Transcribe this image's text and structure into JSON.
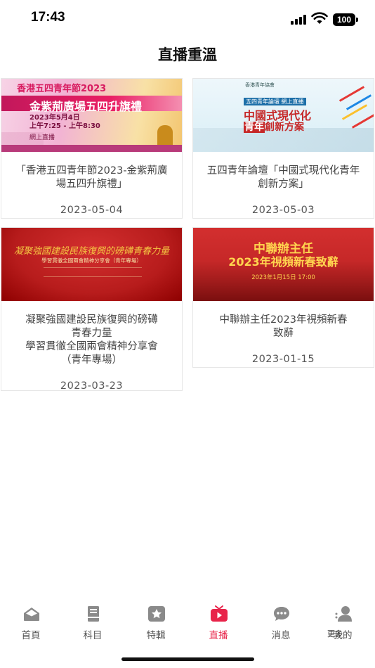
{
  "status_bar": {
    "time": "17:43",
    "battery": "100"
  },
  "page_title": "直播重溫",
  "cards": [
    {
      "title": "「香港五四青年節2023-金紫荊廣場五四升旗禮」",
      "date": "2023-05-04",
      "thumb": {
        "line1": "香港五四青年節2023",
        "line2": "金紫荊廣場五四升旗禮",
        "line3": "2023年5月4日\n上午7:25 - 上午8:30",
        "line4": "網上直播"
      }
    },
    {
      "title": "五四青年論壇「中國式現代化青年創新方案」",
      "date": "2023-05-03",
      "thumb": {
        "line0": "香港青年協會",
        "line1": "五四青年論壇 網上直播",
        "line2": "中國式現代化",
        "line3a": "青年",
        "line3b": "創新方案"
      }
    },
    {
      "title": "凝聚強國建設民族復興的磅礡\n青春力量\n學習貫徹全國兩會精神分享會\n（青年專場）",
      "date": "2023-03-23",
      "thumb": {
        "line1": "凝聚強國建設民族復興的磅礡青春力量",
        "line2": "學習貫徹全國兩會精神分享會（青年專場）"
      }
    },
    {
      "title": "中聯辦主任2023年視頻新春\n致辭",
      "date": "2023-01-15",
      "thumb": {
        "line1": "中聯辦主任",
        "line2": "2023年視頻新春致辭",
        "line3": "2023年1月15日 17:00"
      }
    }
  ],
  "tabs": [
    {
      "label": "首頁",
      "icon": "home-icon"
    },
    {
      "label": "科目",
      "icon": "book-icon"
    },
    {
      "label": "特輯",
      "icon": "star-icon"
    },
    {
      "label": "直播",
      "icon": "tv-play-icon",
      "active": true
    },
    {
      "label": "消息",
      "icon": "chat-bubble-icon"
    },
    {
      "label": "我的",
      "icon": "user-icon"
    }
  ],
  "more_label": "更多",
  "colors": {
    "accent": "#e8244a",
    "tab_inactive": "#555555"
  }
}
